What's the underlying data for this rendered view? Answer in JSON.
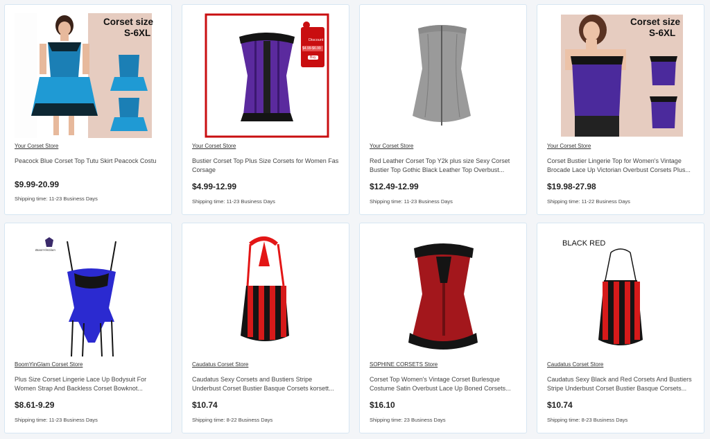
{
  "products": [
    {
      "store": "Your Corset Store",
      "title": "Peacock Blue Corset Top Tutu Skirt Peacock Costu",
      "price": "$9.99-20.99",
      "shipping": "Shipping time: 11-23 Business Days",
      "image_overlay": "Corset size",
      "image_overlay_sub": "S-6XL",
      "colors": {
        "main": "#1b7fb5",
        "trim": "#0d2733"
      }
    },
    {
      "store": "Your Corset Store",
      "title": "Bustier Corset Top Plus Size Corsets for Women Fas Corsage",
      "price": "$4.99-12.99",
      "shipping": "Shipping time: 11-23 Business Days",
      "image_badge_title": "Discount",
      "image_badge_price": "$4.99-$6.99",
      "image_badge_cta": "Buy",
      "colors": {
        "main": "#5b2a9e",
        "trim": "#141414",
        "frame": "#c90e10"
      }
    },
    {
      "store": "Your Corset Store",
      "title": "Red Leather Corset Top Y2k plus size Sexy Corset Bustier Top Gothic Black Leather Top Overbust...",
      "price": "$12.49-12.99",
      "shipping": "Shipping time: 11-23 Business Days",
      "colors": {
        "main": "#9a9a9a",
        "trim": "#6e6e6e"
      }
    },
    {
      "store": "Your Corset Store",
      "title": "Corset Bustier Lingerie Top for Women's Vintage Brocade Lace Up Victorian Overbust Corsets Plus...",
      "price": "$19.98-27.98",
      "shipping": "Shipping time: 11-22 Business Days",
      "image_overlay": "Corset size",
      "image_overlay_sub": "S-6XL",
      "colors": {
        "main": "#4b2a9c",
        "trim": "#141414"
      }
    },
    {
      "store": "BoomYinGlam Corset Store",
      "title": "Plus Size Corset Lingerie Lace Up Bodysuit For Women Strap And Backless Corset Bowknot...",
      "price": "$8.61-9.29",
      "shipping": "Shipping time: 11-23 Business Days",
      "image_logo_text": "BoomYinGlam",
      "colors": {
        "main": "#2b2ad0",
        "trim": "#141414"
      }
    },
    {
      "store": "Caudatus Corset Store",
      "title": "Caudatus Sexy Corsets and Bustiers Stripe Underbust Corset Bustier Basque Corsets korsett...",
      "price": "$10.74",
      "shipping": "Shipping time: 8-22 Business Days",
      "colors": {
        "main": "#d61a1a",
        "trim": "#141414"
      }
    },
    {
      "store": "SOPHINE CORSETS Store",
      "title": "Corset Top Women's Vintage Corset Burlesque Costume Satin Overbust Lace Up Boned Corsets...",
      "price": "$16.10",
      "shipping": "Shipping time: 23 Business Days",
      "colors": {
        "main": "#a3171c",
        "trim": "#141414"
      }
    },
    {
      "store": "Caudatus Corset Store",
      "title": "Caudatus Sexy Black and Red Corsets And Bustiers Stripe Underbust Corset Bustier Basque Corsets...",
      "price": "$10.74",
      "shipping": "Shipping time: 8-23 Business Days",
      "image_overlay": "BLACK RED",
      "colors": {
        "main": "#d61a1a",
        "trim": "#141414"
      }
    }
  ]
}
